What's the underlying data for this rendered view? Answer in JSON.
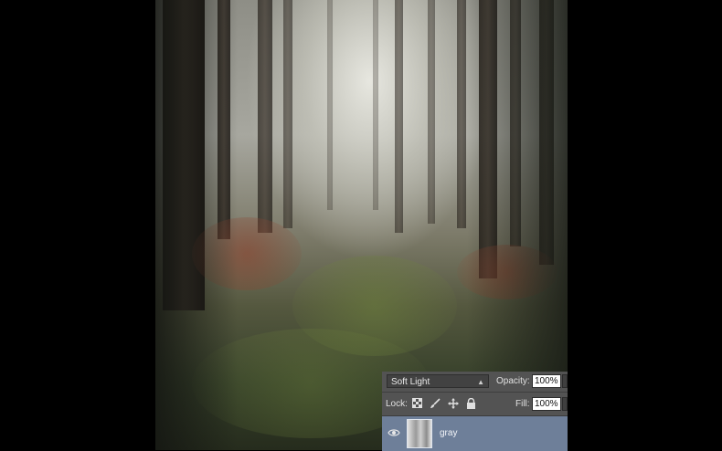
{
  "photo": {
    "subject": "forest-image"
  },
  "layers_panel": {
    "blend_mode": "Soft Light",
    "opacity_label": "Opacity:",
    "opacity_value": "100%",
    "lock_label": "Lock:",
    "fill_label": "Fill:",
    "fill_value": "100%",
    "lock_icons": [
      "lock-transparent-pixels-icon",
      "lock-image-pixels-icon",
      "lock-position-icon",
      "lock-all-icon"
    ],
    "layer": {
      "name": "gray",
      "visible": true
    }
  },
  "colors": {
    "panel_bg": "#535353",
    "selected_layer_bg": "#6e7f99"
  }
}
